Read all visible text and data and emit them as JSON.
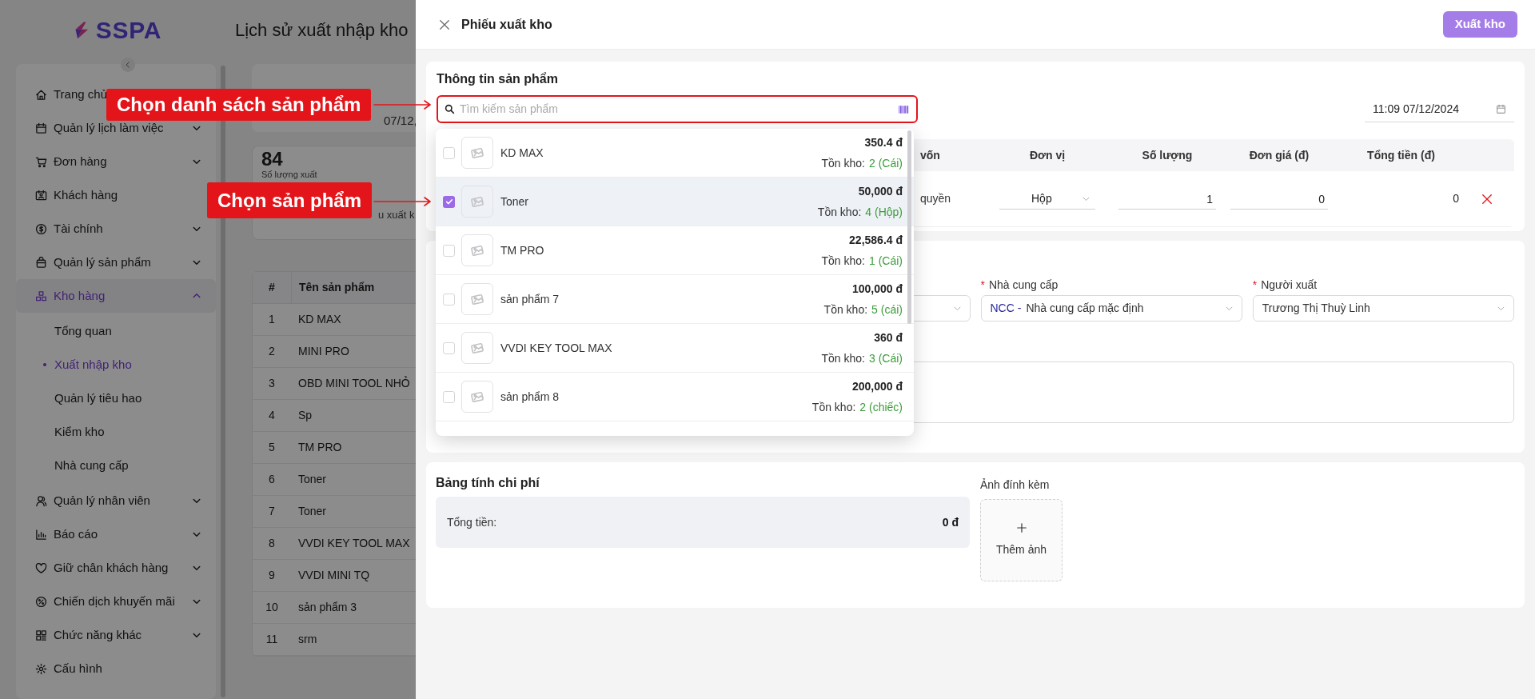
{
  "app": {
    "logo": "SSPA",
    "page_title": "Lịch sử xuất nhập kho"
  },
  "sidebar": {
    "items": [
      {
        "label": "Trang chủ",
        "selected": false
      },
      {
        "label": "Quản lý lịch làm việc",
        "expandable": true,
        "expanded": false,
        "selected": false
      },
      {
        "label": "Đơn hàng",
        "expandable": true,
        "expanded": false,
        "selected": false
      },
      {
        "label": "Khách hàng",
        "expandable": false,
        "selected": false
      },
      {
        "label": "Tài chính",
        "expandable": true,
        "expanded": false,
        "selected": false
      },
      {
        "label": "Quản lý sản phẩm",
        "expandable": true,
        "expanded": false,
        "selected": false
      },
      {
        "label": "Kho hàng",
        "expandable": true,
        "expanded": true,
        "selected": true,
        "children": [
          {
            "label": "Tổng quan",
            "selected": false
          },
          {
            "label": "Xuất nhập kho",
            "selected": true
          },
          {
            "label": "Quản lý tiêu hao",
            "selected": false
          },
          {
            "label": "Kiểm kho",
            "selected": false
          },
          {
            "label": "Nhà cung cấp",
            "selected": false
          }
        ]
      },
      {
        "label": "Quản lý nhân viên",
        "expandable": true,
        "expanded": false,
        "selected": false
      },
      {
        "label": "Báo cáo",
        "expandable": true,
        "expanded": false,
        "selected": false
      },
      {
        "label": "Giữ chân khách hàng",
        "expandable": true,
        "expanded": false,
        "selected": false
      },
      {
        "label": "Chiến dịch khuyến mãi",
        "expandable": true,
        "expanded": false,
        "selected": false
      },
      {
        "label": "Chức năng khác",
        "expandable": true,
        "expanded": false,
        "selected": false
      },
      {
        "label": "Cấu hình",
        "expandable": false,
        "selected": false
      }
    ]
  },
  "background": {
    "date_value": "07/12,",
    "stat": {
      "value": "84",
      "label": "Số lượng xuất"
    },
    "column_text": "u xuất k",
    "table": {
      "columns": [
        "#",
        "Tên sản phẩm"
      ],
      "rows": [
        [
          "1",
          "KD MAX"
        ],
        [
          "2",
          "MINI PRO"
        ],
        [
          "3",
          "OBD MINI TOOL NHỎ"
        ],
        [
          "4",
          "Sp"
        ],
        [
          "5",
          "TM PRO"
        ],
        [
          "6",
          "Toner"
        ],
        [
          "7",
          "Toner"
        ],
        [
          "8",
          "VVDI KEY TOOL MAX"
        ],
        [
          "9",
          "VVDI MINI TQ"
        ],
        [
          "10",
          "sản phẩm 3"
        ],
        [
          "11",
          "srm"
        ]
      ]
    }
  },
  "annotations": [
    {
      "text": "Chọn danh sách sản phẩm"
    },
    {
      "text": "Chọn sản phẩm"
    }
  ],
  "drawer": {
    "title": "Phiếu xuất kho",
    "primary_button": "Xuất kho",
    "product_section": {
      "title": "Thông tin sản phẩm",
      "search_placeholder": "Tìm kiếm sản phẩm",
      "datetime": "11:09 07/12/2024",
      "table": {
        "columns": [
          "vốn",
          "Đơn vị",
          "Số lượng",
          "Đơn giá (đ)",
          "Tổng tiền (đ)"
        ],
        "rows": [
          {
            "column_1": "quyền",
            "unit": "Hộp",
            "quantity": "1",
            "unit_price": "0",
            "total": "0"
          }
        ]
      }
    },
    "dropdown": {
      "items": [
        {
          "name": "KD MAX",
          "price": "350.4 đ",
          "stock_label": "Tồn kho:",
          "stock": "2 (Cái)",
          "selected": false
        },
        {
          "name": "Toner",
          "price": "50,000 đ",
          "stock_label": "Tồn kho:",
          "stock": "4 (Hộp)",
          "selected": true
        },
        {
          "name": "TM PRO",
          "price": "22,586.4 đ",
          "stock_label": "Tồn kho:",
          "stock": "1 (Cái)",
          "selected": false
        },
        {
          "name": "sản phẩm 7",
          "price": "100,000 đ",
          "stock_label": "Tồn kho:",
          "stock": "5 (cái)",
          "selected": false
        },
        {
          "name": "VVDI KEY TOOL MAX",
          "price": "360 đ",
          "stock_label": "Tồn kho:",
          "stock": "3 (Cái)",
          "selected": false
        },
        {
          "name": "sản phẩm 8",
          "price": "200,000 đ",
          "stock_label": "Tồn kho:",
          "stock": "2 (chiếc)",
          "selected": false
        }
      ]
    },
    "info_section": {
      "fields": [
        {
          "label": "Nhà cung cấp",
          "required_mark": "*",
          "code": "NCC -",
          "value": "Nhà cung cấp mặc định"
        },
        {
          "label": "Người xuất",
          "required_mark": "*",
          "value": "Trương Thị Thuỳ Linh"
        }
      ]
    },
    "cost_section": {
      "title": "Bảng tính chi phí",
      "total_label": "Tổng tiền:",
      "total_value": "0 đ",
      "attachments_label": "Ảnh đính kèm",
      "add_photo": "Thêm ảnh"
    }
  }
}
